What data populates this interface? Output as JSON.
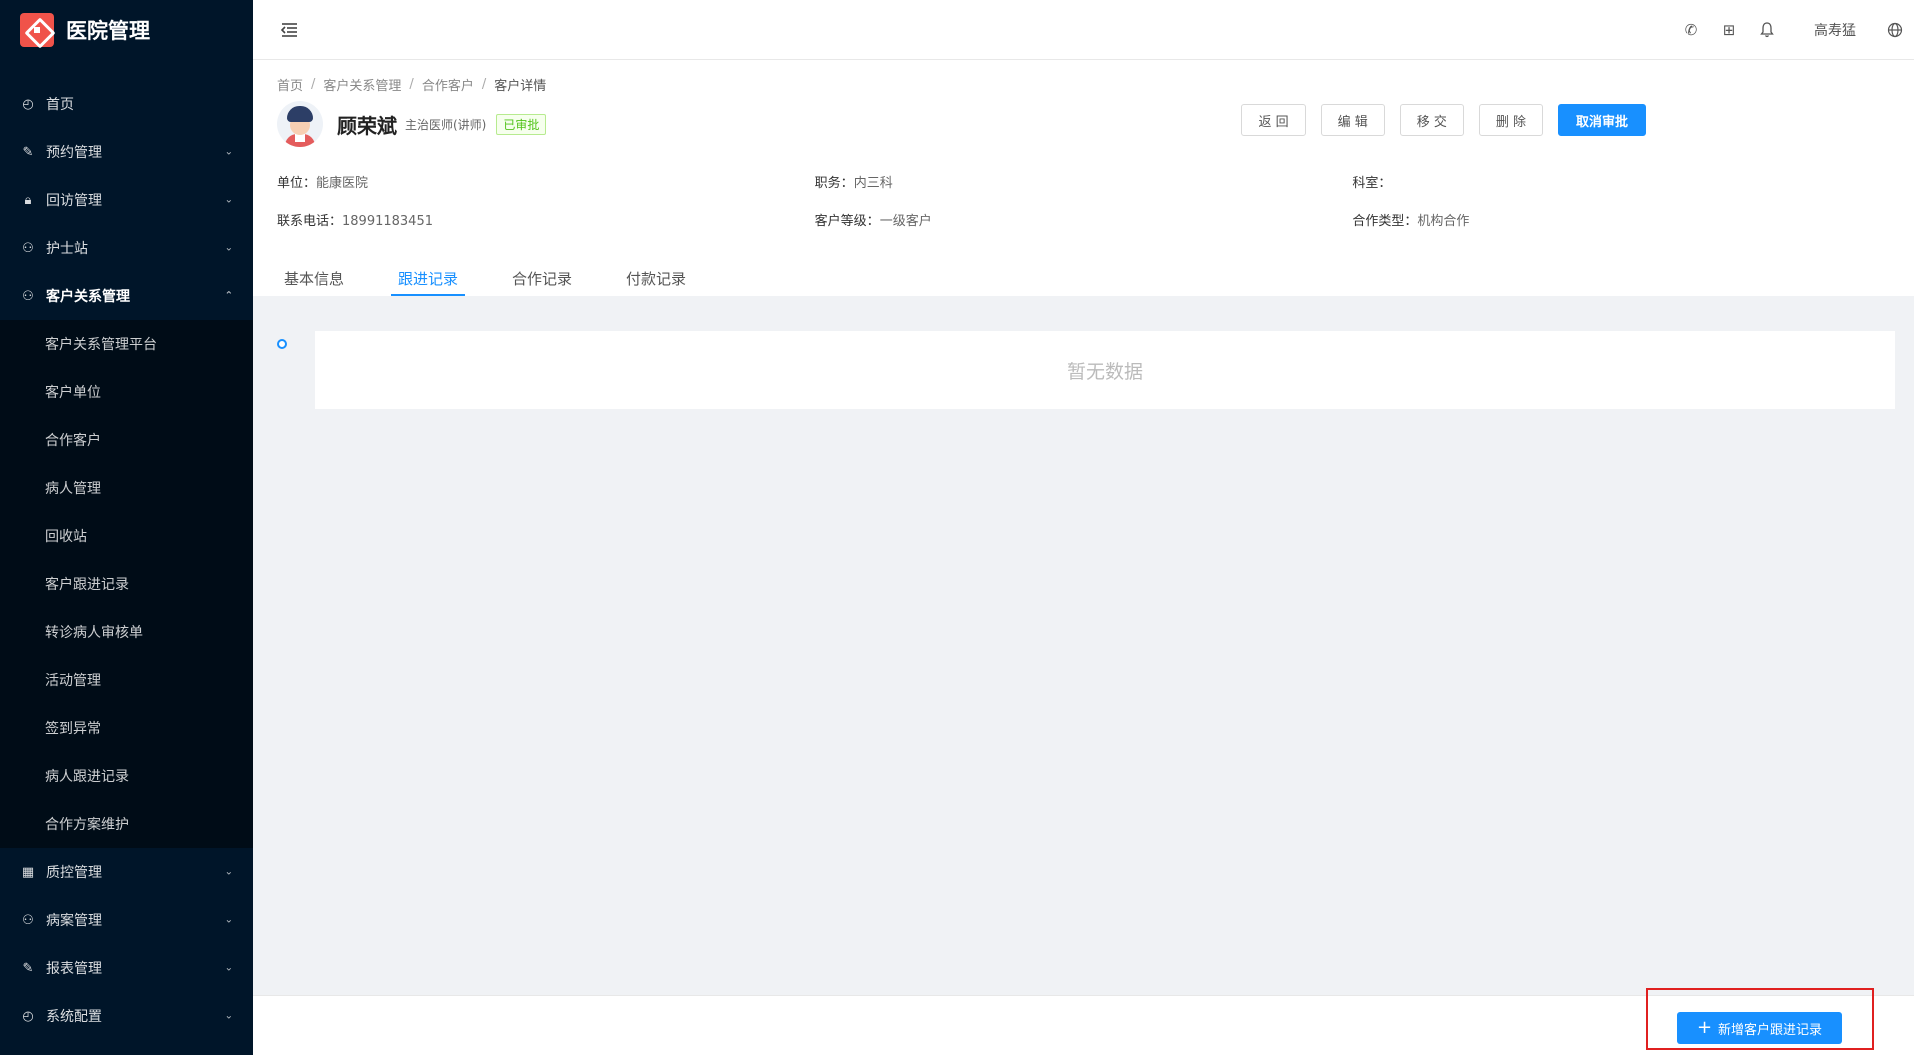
{
  "app": {
    "title": "医院管理"
  },
  "sidebar": {
    "items": [
      {
        "label": "首页",
        "icon": "dashboard-icon",
        "expandable": false
      },
      {
        "label": "预约管理",
        "icon": "edit-icon",
        "expandable": true
      },
      {
        "label": "回访管理",
        "icon": "lock-icon",
        "expandable": true
      },
      {
        "label": "护士站",
        "icon": "user-icon",
        "expandable": true
      },
      {
        "label": "客户关系管理",
        "icon": "user-icon",
        "expandable": true,
        "expanded": true
      }
    ],
    "submenu": [
      "客户关系管理平台",
      "客户单位",
      "合作客户",
      "病人管理",
      "回收站",
      "客户跟进记录",
      "转诊病人审核单",
      "活动管理",
      "签到异常",
      "病人跟进记录",
      "合作方案维护"
    ],
    "items_after": [
      {
        "label": "质控管理",
        "icon": "table-icon"
      },
      {
        "label": "病案管理",
        "icon": "user-icon"
      },
      {
        "label": "报表管理",
        "icon": "edit-icon"
      },
      {
        "label": "系统配置",
        "icon": "dashboard-icon"
      }
    ]
  },
  "header": {
    "username": "高寿猛"
  },
  "breadcrumb": [
    "首页",
    "客户关系管理",
    "合作客户",
    "客户详情"
  ],
  "customer": {
    "name": "顾荣斌",
    "title": "主治医师(讲师)",
    "status": "已审批",
    "unit_label": "单位：",
    "unit": "能康医院",
    "position_label": "职务：",
    "position": "内三科",
    "dept_label": "科室：",
    "dept": "",
    "phone_label": "联系电话：",
    "phone": "18991183451",
    "level_label": "客户等级：",
    "level": "一级客户",
    "coop_label": "合作类型：",
    "coop": "机构合作"
  },
  "actions": {
    "back": "返 回",
    "edit": "编 辑",
    "transfer": "移 交",
    "delete": "删 除",
    "cancel_approval": "取消审批"
  },
  "tabs": [
    "基本信息",
    "跟进记录",
    "合作记录",
    "付款记录"
  ],
  "empty_text": "暂无数据",
  "footer": {
    "add_button": "新增客户跟进记录"
  },
  "colors": {
    "sidebar_bg": "#001529",
    "primary": "#1890ff",
    "highlight": "#e02020",
    "status_green": "#52c41a"
  }
}
